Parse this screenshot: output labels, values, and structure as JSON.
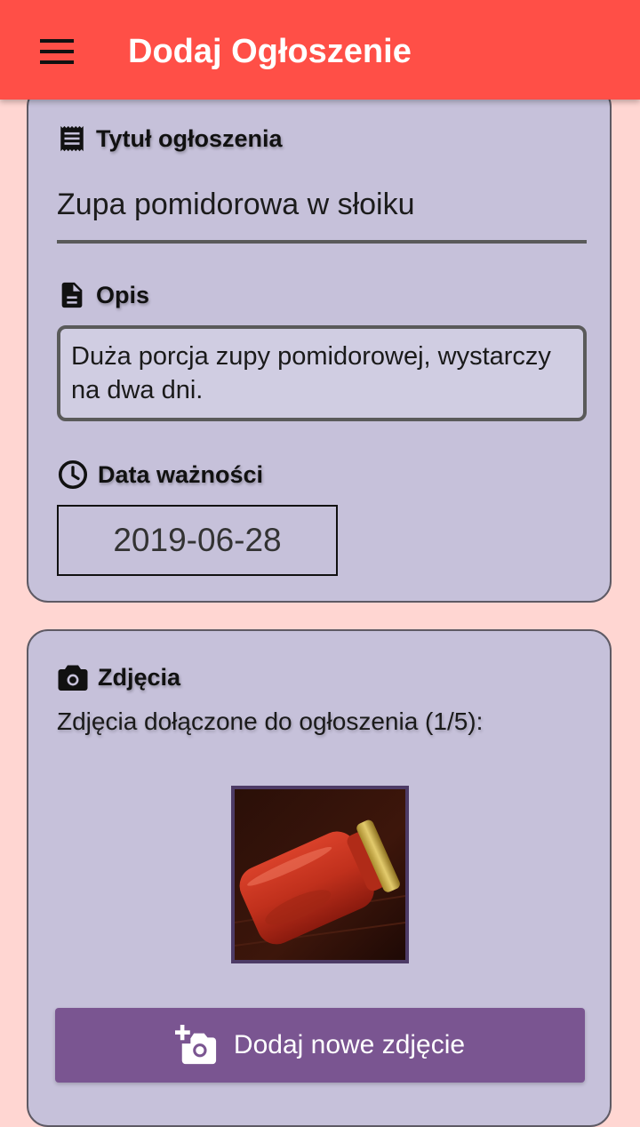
{
  "appbar": {
    "title": "Dodaj Ogłoszenie",
    "menu_icon": "menu-icon",
    "color": "#ff4f47"
  },
  "form": {
    "title_label": "Tytuł ogłoszenia",
    "title_icon": "receipt-icon",
    "title_value": "Zupa pomidorowa w słoiku",
    "description_label": "Opis",
    "description_icon": "document-icon",
    "description_value": "Duża porcja zupy pomidorowej, wystarczy na dwa dni.",
    "expiry_label": "Data ważności",
    "expiry_icon": "clock-icon",
    "expiry_value": "2019-06-28"
  },
  "photos": {
    "section_label": "Zdjęcia",
    "section_icon": "camera-icon",
    "caption": "Zdjęcia dołączone do ogłoszenia (1/5):",
    "add_button_label": "Dodaj nowe zdjęcie",
    "add_button_icon": "add-photo-icon",
    "add_button_color": "#7a5591"
  },
  "colors": {
    "background": "#ffd6d2",
    "card": "#c6c1da"
  }
}
